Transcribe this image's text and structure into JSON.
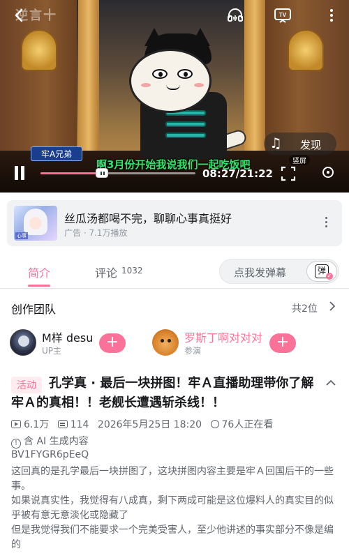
{
  "video": {
    "watermark": "逆言十",
    "name_tag": "牢A兄弟",
    "subtitle": "啊3月份开始我说我们一起吃饭吧",
    "discover_label": "发现",
    "vertical_badge": "竖屏",
    "time_display": "08:27/21:22",
    "progress": 0.397,
    "icons": {
      "back": "back-arrow-icon",
      "audio": "headset-icon",
      "cast": "tv-cast-icon",
      "more": "more-vertical-icon",
      "music": "music-note-icon",
      "pause": "pause-icon",
      "fullscreen": "fullscreen-icon",
      "rotate": "rotate-icon"
    }
  },
  "ad": {
    "title": "丝瓜汤都喝不完，聊聊心事真挺好",
    "meta": "广告 · 7.1万播放",
    "thumb_text": "心事"
  },
  "tabs": {
    "intro": "简介",
    "comments": "评论",
    "comments_count": "1032",
    "danmaku_placeholder": "点我发弹幕",
    "danmaku_glyph": "弹"
  },
  "team": {
    "title": "创作团队",
    "count": "共2位",
    "members": [
      {
        "name": "M样 desu",
        "role": "UP主",
        "follow_label": "+"
      },
      {
        "name": "罗斯丁啊对对对",
        "role": "参演",
        "follow_label": "+"
      }
    ]
  },
  "info": {
    "badge": "活动",
    "title": "孔学真 · 最后一块拼图！牢Ａ直播助理带你了解牢Ａ的真相！！老舰长遭遇斩杀线！！",
    "views": "6.1万",
    "danmaku": "114",
    "date": "2026年5月25日 18:20",
    "watching": "76人正在看",
    "ai_note": "含 AI 生成内容",
    "bvid": "BV1FYGR6pEeQ",
    "description": [
      "这回真的是孔学最后一块拼图了，这块拼图内容主要是牢Ａ回国后干的一些事。",
      "如果说真实性，我觉得有八成真，剩下两成可能是这位爆料人的真实目的似乎被有意无意淡化或隐藏了",
      "但是我觉得我们不能要求一个完美受害人，至少他讲述的事实部分不像是编的"
    ]
  },
  "colors": {
    "accent": "#fb7299",
    "text_primary": "#18191c",
    "text_secondary": "#61666d",
    "subtitle": "#2be76a"
  }
}
